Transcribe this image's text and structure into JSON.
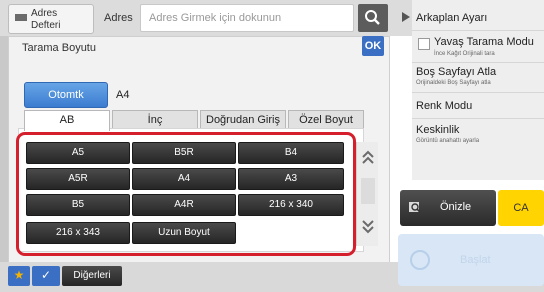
{
  "top": {
    "address_book_label_line1": "Adres",
    "address_book_label_line2": "Defteri",
    "address_label": "Adres",
    "address_placeholder": "Adres Girmek için dokunun"
  },
  "panel": {
    "title": "Tarama Boyutu",
    "ok_label": "OK",
    "auto_label": "Otomtk",
    "current_size": "A4",
    "tabs": [
      {
        "label": "AB",
        "active": true
      },
      {
        "label": "İnç",
        "active": false
      },
      {
        "label": "Doğrudan Giriş",
        "active": false
      },
      {
        "label": "Özel Boyut",
        "active": false
      }
    ],
    "sizes": [
      [
        "A5",
        "B5R",
        "B4"
      ],
      [
        "A5R",
        "A4",
        "A3"
      ],
      [
        "B5",
        "A4R",
        "216 x 340"
      ],
      [
        "216 x 343",
        "Uzun Boyut"
      ]
    ]
  },
  "bottom": {
    "others_label": "Diğerleri"
  },
  "side": {
    "items": [
      {
        "label": "Arkaplan Ayarı",
        "sub": ""
      },
      {
        "label": "Yavaş Tarama Modu",
        "sub": "İnce Kağıt Orijinali tara"
      },
      {
        "label": "Boş Sayfayı Atla",
        "sub": "Orijinaldeki Boş Sayfayı atla"
      },
      {
        "label": "Renk Modu",
        "sub": ""
      },
      {
        "label": "Keskinlik",
        "sub": "Görüntü anahattı ayarla"
      }
    ],
    "preview_label": "Önizle",
    "ca_label": "CA",
    "start_label": "Başlat"
  },
  "colors": {
    "accent": "#3a6fc4",
    "highlight": "#d51f2c",
    "ca": "#ffd400"
  },
  "icons": [
    "book-icon",
    "search-icon",
    "star-icon",
    "check-icon",
    "preview-icon",
    "start-icon",
    "chevron-up-icon",
    "chevron-down-icon",
    "triangle-right-icon"
  ]
}
